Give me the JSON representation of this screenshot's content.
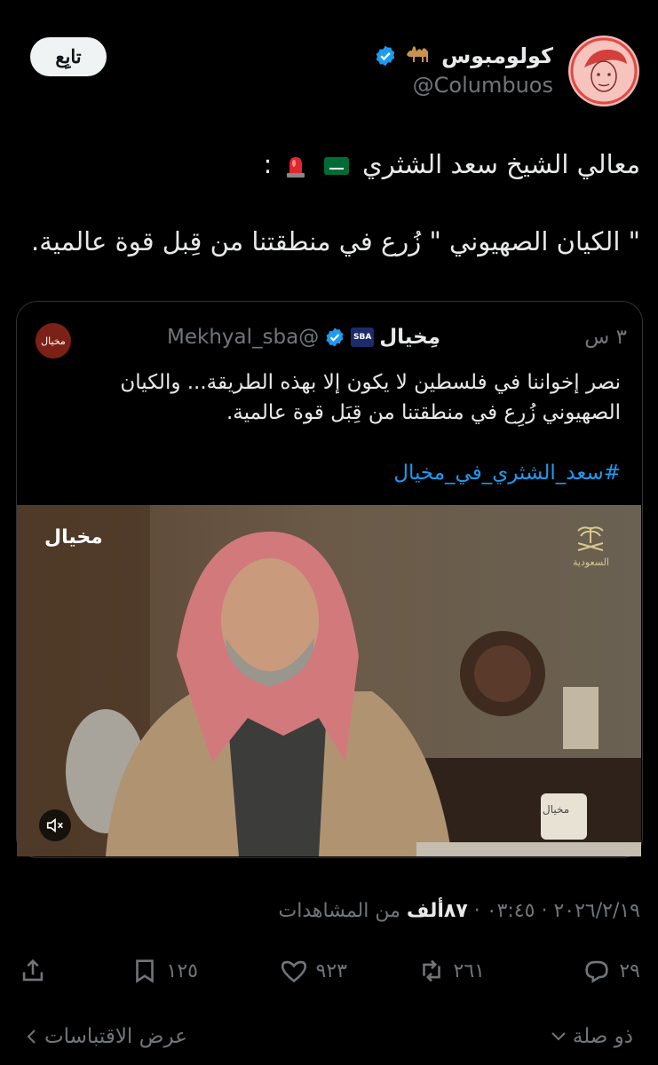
{
  "author": {
    "name": "كولومبوس",
    "handle": "@Columbuos",
    "follow_label": "تابِع"
  },
  "tweet": {
    "line1_text": "معالي الشيخ سعد الشثري",
    "line1_suffix": ":",
    "line2_text": "\" الكيان الصهيوني \" زُرع في منطقتنا من قِبل قوة عالمية."
  },
  "quote": {
    "name": "مِخيال",
    "badge": "SBA",
    "handle": "@Mekhyal_sba",
    "time": "٣ س",
    "avatar_label": "مخيال",
    "text": "نصر إخواننا في فلسطين لا يكون إلا بهذه الطريقة... والكيان الصهيوني زُرِع في منطقتنا من قِبَل قوة عالمية.",
    "hashtag": "#سعد_الشثري_في_مخيال",
    "video": {
      "watermark": "مخيال",
      "logo_text": "السعودية",
      "mug_text": "مخيال"
    }
  },
  "meta": {
    "date": "٢٠٢٦/٢/١٩",
    "time": "٠٣:٤٥",
    "views_count": "٨٧ألف",
    "views_label": "من المشاهدات"
  },
  "actions": {
    "replies": "٢٩",
    "reposts": "٢٦١",
    "likes": "٩٢٣",
    "bookmarks": "١٢٥"
  },
  "footer": {
    "left_label": "عرض الاقتباسات",
    "right_label": "ذو صلة"
  },
  "colors": {
    "accent": "#1d9bf0",
    "muted": "#71767b",
    "text": "#e7e9ea"
  }
}
